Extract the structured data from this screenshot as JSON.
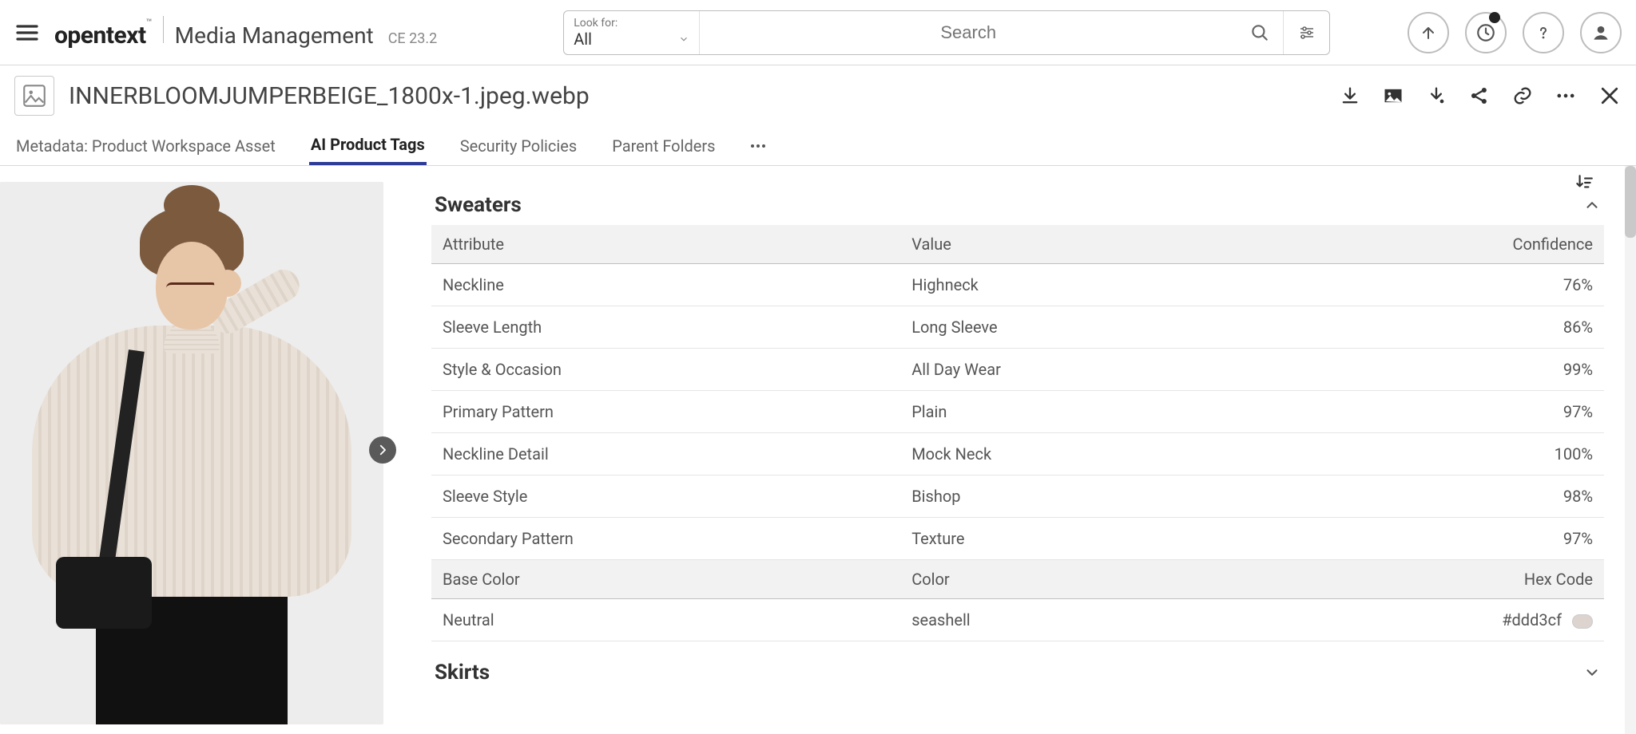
{
  "brand": {
    "logo": "opentext",
    "tm": "™",
    "product": "Media Management",
    "version": "CE 23.2"
  },
  "search": {
    "lookfor_label": "Look for:",
    "lookfor_value": "All",
    "placeholder": "Search"
  },
  "asset": {
    "filename": "INNERBLOOMJUMPERBEIGE_1800x-1.jpeg.webp"
  },
  "tabs": [
    {
      "label": "Metadata: Product Workspace Asset",
      "active": false
    },
    {
      "label": "AI Product Tags",
      "active": true
    },
    {
      "label": "Security Policies",
      "active": false
    },
    {
      "label": "Parent Folders",
      "active": false
    }
  ],
  "sections": [
    {
      "title": "Sweaters",
      "expanded": true,
      "columns": {
        "attr": "Attribute",
        "value": "Value",
        "conf": "Confidence"
      },
      "rows": [
        {
          "attr": "Neckline",
          "value": "Highneck",
          "conf": "76%"
        },
        {
          "attr": "Sleeve Length",
          "value": "Long Sleeve",
          "conf": "86%"
        },
        {
          "attr": "Style & Occasion",
          "value": "All Day Wear",
          "conf": "99%"
        },
        {
          "attr": "Primary Pattern",
          "value": "Plain",
          "conf": "97%"
        },
        {
          "attr": "Neckline Detail",
          "value": "Mock Neck",
          "conf": "100%"
        },
        {
          "attr": "Sleeve Style",
          "value": "Bishop",
          "conf": "98%"
        },
        {
          "attr": "Secondary Pattern",
          "value": "Texture",
          "conf": "97%"
        }
      ],
      "color_columns": {
        "base": "Base Color",
        "color": "Color",
        "hex": "Hex Code"
      },
      "color_rows": [
        {
          "base": "Neutral",
          "color": "seashell",
          "hex": "#ddd3cf"
        }
      ]
    },
    {
      "title": "Skirts",
      "expanded": false
    }
  ]
}
